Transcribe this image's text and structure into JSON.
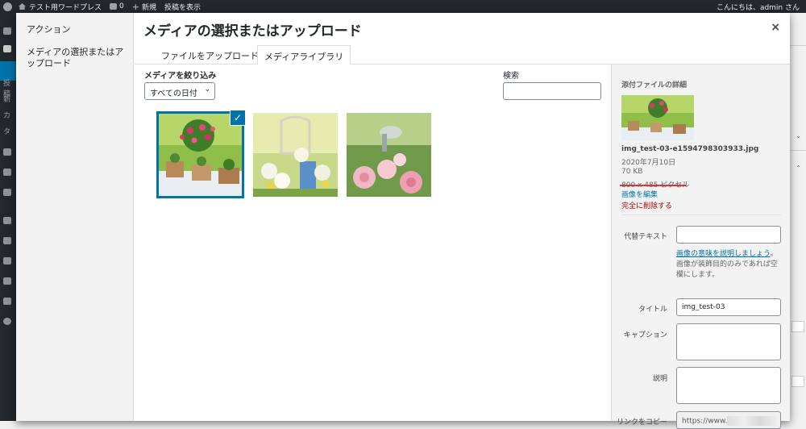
{
  "adminbar": {
    "site_name": "テスト用ワードプレス",
    "comments_count": "0",
    "new_label": "新規",
    "view_post": "投稿を表示",
    "howdy": "こんにちは、admin さん"
  },
  "adminmenu": {
    "labels": [
      "投稿",
      "新",
      "カ",
      "タ"
    ]
  },
  "modal": {
    "title": "メディアの選択またはアップロード",
    "close": "×",
    "menu": {
      "actions": "アクション",
      "select_upload": "メディアの選択またはアップロード"
    },
    "tabs": {
      "upload": "ファイルをアップロード",
      "library": "メディアライブラリ"
    },
    "filter": {
      "label": "メディアを絞り込み",
      "date_selected": "すべての日付"
    },
    "search": {
      "label": "検索",
      "value": ""
    },
    "attachments": [
      {
        "name": "potted-flowers",
        "selected": true,
        "check": "✓"
      },
      {
        "name": "white-flowers",
        "selected": false
      },
      {
        "name": "pink-peonies",
        "selected": false
      }
    ],
    "details": {
      "title": "添付ファイルの詳細",
      "filename": "img_test-03-e1594798303933.jpg",
      "date": "2020年7月10日",
      "size": "70 KB",
      "dimensions": "800 x 485 ピクセル",
      "edit_link": "画像を編集",
      "delete_link": "完全に削除する",
      "alt_label": "代替テキスト",
      "alt_value": "",
      "alt_help_link": "画像の意味を説明しましょう",
      "alt_help_rest": "。画像が装飾目的のみであれば空欄にします。",
      "title_label": "タイトル",
      "title_value": "img_test-03",
      "caption_label": "キャプション",
      "caption_value": "",
      "description_label": "説明",
      "description_value": "",
      "copy_link_label": "リンクをコピー",
      "url_value": "https://www."
    }
  }
}
